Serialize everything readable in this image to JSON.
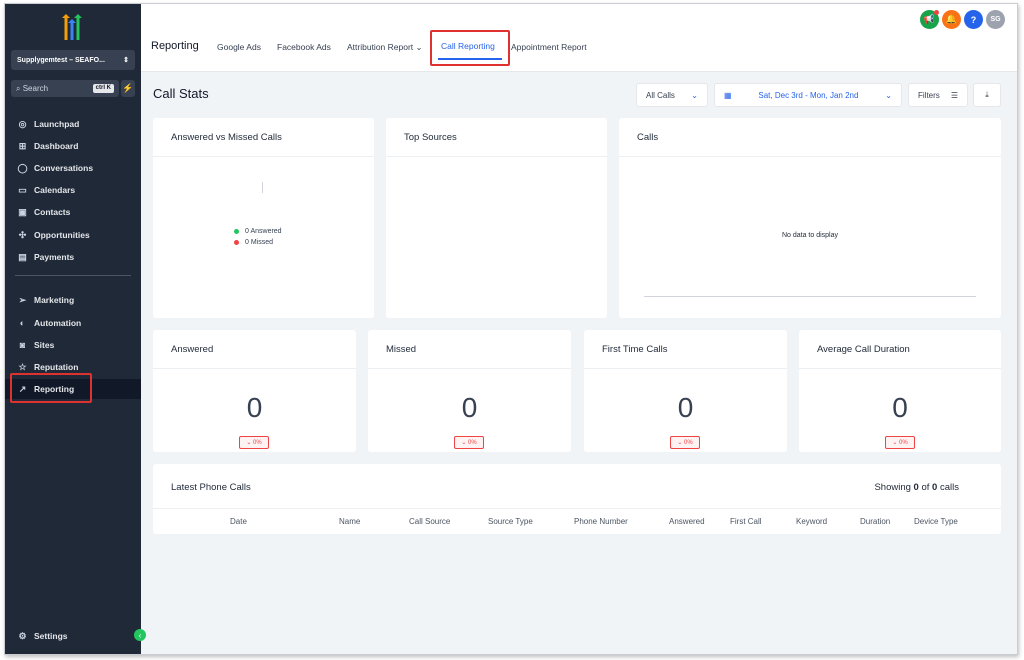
{
  "sidebar": {
    "account": "Supplygemtest – SEAFO...",
    "search_placeholder": "Search",
    "search_shortcut": "ctrl K",
    "items": [
      {
        "label": "Launchpad",
        "icon": "launchpad-icon"
      },
      {
        "label": "Dashboard",
        "icon": "dashboard-icon"
      },
      {
        "label": "Conversations",
        "icon": "chat-icon"
      },
      {
        "label": "Calendars",
        "icon": "calendar-icon"
      },
      {
        "label": "Contacts",
        "icon": "contacts-icon"
      },
      {
        "label": "Opportunities",
        "icon": "opportunities-icon"
      },
      {
        "label": "Payments",
        "icon": "payments-icon"
      },
      {
        "label": "Marketing",
        "icon": "send-icon"
      },
      {
        "label": "Automation",
        "icon": "automation-icon"
      },
      {
        "label": "Sites",
        "icon": "sites-icon"
      },
      {
        "label": "Reputation",
        "icon": "star-icon"
      },
      {
        "label": "Reporting",
        "icon": "trend-icon"
      }
    ],
    "settings_label": "Settings"
  },
  "header": {
    "title": "Reporting",
    "tabs": [
      {
        "label": "Google Ads"
      },
      {
        "label": "Facebook Ads"
      },
      {
        "label": "Attribution Report ⌄"
      },
      {
        "label": "Call Reporting"
      },
      {
        "label": "Appointment Report"
      }
    ],
    "avatar_initials": "SG",
    "help_glyph": "?"
  },
  "main": {
    "title": "Call Stats",
    "call_filter": "All Calls",
    "date_range": "Sat, Dec 3rd - Mon, Jan 2nd",
    "filters_label": "Filters",
    "charts": {
      "answered_missed_title": "Answered vs Missed Calls",
      "answered_legend": "0 Answered",
      "missed_legend": "0 Missed",
      "top_sources_title": "Top Sources",
      "calls_title": "Calls",
      "no_data": "No data to display"
    },
    "stats": [
      {
        "title": "Answered",
        "value": "0",
        "change": "⌄ 0%"
      },
      {
        "title": "Missed",
        "value": "0",
        "change": "⌄ 0%"
      },
      {
        "title": "First Time Calls",
        "value": "0",
        "change": "⌄ 0%"
      },
      {
        "title": "Average Call Duration",
        "value": "0",
        "change": "⌄ 0%"
      }
    ],
    "latest": {
      "title": "Latest Phone Calls",
      "showing_prefix": "Showing ",
      "shown": "0",
      "of": " of ",
      "total": "0",
      "suffix": " calls",
      "columns": [
        "Date",
        "Name",
        "Call Source",
        "Source Type",
        "Phone Number",
        "Answered",
        "First Call",
        "Keyword",
        "Duration",
        "Device Type"
      ]
    }
  },
  "colors": {
    "sidebar_bg": "#1f2937",
    "accent": "#2563eb",
    "answered": "#22c55e",
    "missed": "#ef4444",
    "highlight": "#e03131"
  }
}
